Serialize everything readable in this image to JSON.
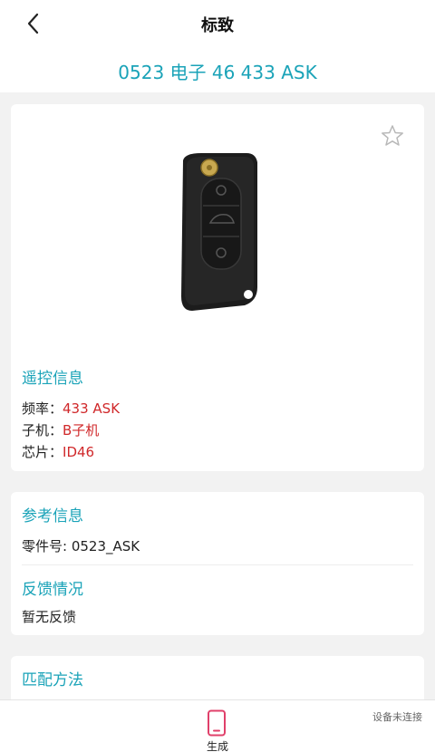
{
  "nav": {
    "title": "标致"
  },
  "subtitle": "0523 电子 46 433 ASK",
  "remote_info": {
    "title": "遥控信息",
    "frequency_label": "频率：",
    "frequency_value": "433 ASK",
    "handset_label": "子机：",
    "handset_value": "B子机",
    "chip_label": "芯片：",
    "chip_value": "ID46"
  },
  "reference_info": {
    "title": "参考信息",
    "part_number": "零件号: 0523_ASK"
  },
  "feedback": {
    "title": "反馈情况",
    "text": "暂无反馈"
  },
  "match_method": {
    "title": "匹配方法"
  },
  "bottom_bar": {
    "tab_label": "生成",
    "connection_status": "设备未连接"
  },
  "colors": {
    "accent": "#1aa3b8",
    "value_red": "#d0282a",
    "tab_icon": "#e0406a"
  },
  "icons": [
    "back-arrow-icon",
    "star-icon",
    "phone-icon"
  ]
}
